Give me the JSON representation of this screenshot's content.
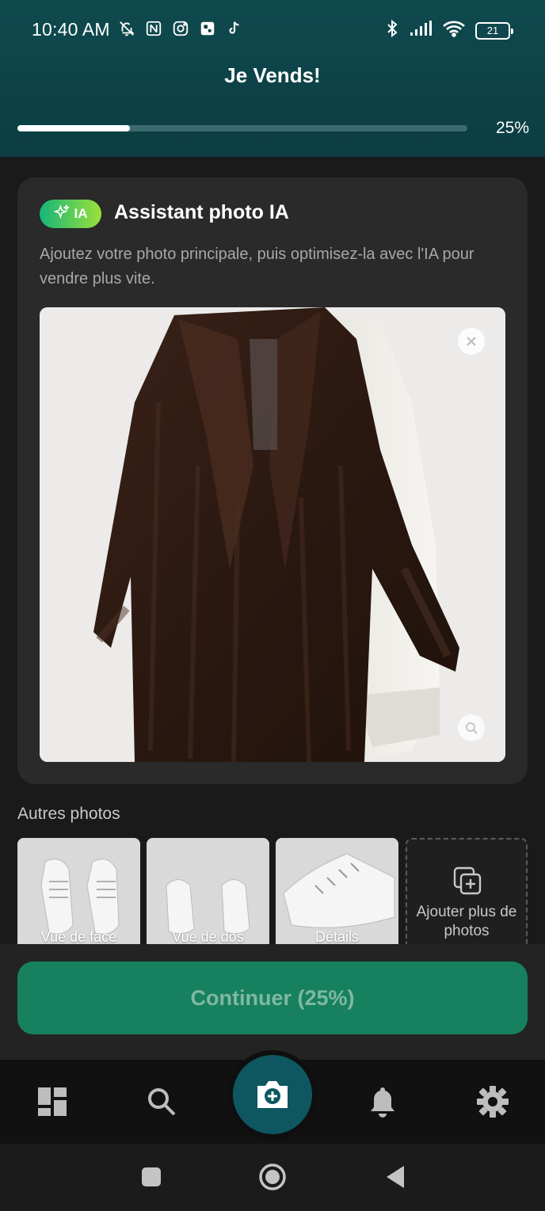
{
  "status_bar": {
    "time": "10:40 AM",
    "battery": "21",
    "icons": [
      "mute-icon",
      "nfc-icon",
      "instagram-icon",
      "app-icon",
      "tiktok-icon",
      "bluetooth-icon",
      "signal-icon",
      "wifi-icon",
      "battery-icon"
    ]
  },
  "header": {
    "title": "Je Vends!",
    "progress_percent": 25,
    "progress_label": "25%"
  },
  "ai_card": {
    "badge": "IA",
    "title": "Assistant photo IA",
    "description": "Ajoutez votre photo principale, puis optimisez-la avec l'IA pour vendre plus vite.",
    "photo_subject": "brown fur coat on hanger"
  },
  "other_photos": {
    "label": "Autres photos",
    "thumbnails": [
      {
        "label": "Vue de face"
      },
      {
        "label": "Vue de dos"
      },
      {
        "label": "Détails"
      }
    ],
    "add_more": "Ajouter plus de photos"
  },
  "continue_button": "Continuer (25%)",
  "bottom_nav": [
    "dashboard-icon",
    "search-icon",
    "camera-add-icon",
    "bell-icon",
    "settings-icon"
  ],
  "colors": {
    "header_bg": "#0b3d42",
    "accent": "#17805f",
    "fab": "#0e5760",
    "badge_gradient": [
      "#17b57a",
      "#9be13a"
    ]
  }
}
